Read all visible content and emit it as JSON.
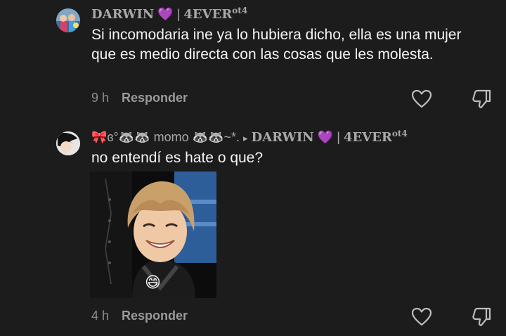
{
  "comments": [
    {
      "username": {
        "name": "DARWIN",
        "heart": "💜",
        "separator": "|",
        "tag": "4EVER",
        "tag_sup": "ot4"
      },
      "text": "Si incomodaria ine ya lo hubiera dicho, ella es una mujer que es medio directa con las cosas que les molesta.",
      "time": "9 h",
      "reply_label": "Responder"
    },
    {
      "username": {
        "prefix": "🎀ɞ°🦝🦝",
        "name": "momo",
        "suffix": "🦝🦝~*.",
        "reply_arrow": "▸",
        "reply_to_name": "DARWIN",
        "reply_to_heart": "💜",
        "reply_to_separator": "|",
        "reply_to_tag": "4EVER",
        "reply_to_sup": "ot4"
      },
      "text": "no entendí es hate o que?",
      "media_emoji": "😄",
      "time": "4 h",
      "reply_label": "Responder"
    }
  ],
  "icons": {
    "like": "heart-outline-icon",
    "dislike": "thumbs-down-icon"
  },
  "colors": {
    "background": "#1c1c1c",
    "text": "#f4f4f4",
    "muted": "#a8a8a8"
  }
}
